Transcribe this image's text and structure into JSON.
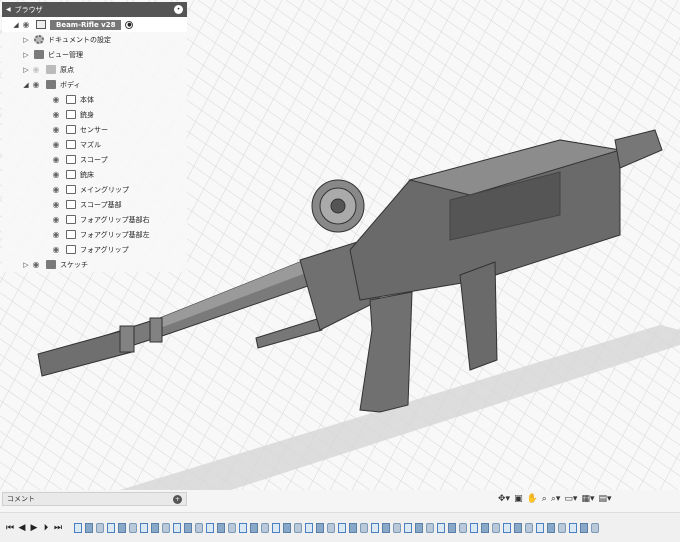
{
  "browser": {
    "title": "ブラウザ",
    "root": "Beam-Rifle v28",
    "items": [
      {
        "label": "ドキュメントの設定",
        "kind": "gear"
      },
      {
        "label": "ビュー管理",
        "kind": "folder"
      },
      {
        "label": "原点",
        "kind": "folder-light"
      },
      {
        "label": "ボディ",
        "kind": "folder"
      },
      {
        "label": "本体",
        "kind": "body"
      },
      {
        "label": "銃身",
        "kind": "body"
      },
      {
        "label": "センサー",
        "kind": "body"
      },
      {
        "label": "マズル",
        "kind": "body"
      },
      {
        "label": "スコープ",
        "kind": "body"
      },
      {
        "label": "銃床",
        "kind": "body"
      },
      {
        "label": "メイングリップ",
        "kind": "body"
      },
      {
        "label": "スコープ基部",
        "kind": "body"
      },
      {
        "label": "フォアグリップ基部右",
        "kind": "body"
      },
      {
        "label": "フォアグリップ基部左",
        "kind": "body"
      },
      {
        "label": "フォアグリップ",
        "kind": "body"
      },
      {
        "label": "スケッチ",
        "kind": "folder"
      }
    ]
  },
  "comment": {
    "title": "コメント"
  },
  "navbar": {
    "icons": [
      "orbit-icon",
      "pan-icon",
      "hand-icon",
      "zoom-icon",
      "display-icon",
      "grid-icon",
      "viewport-icon"
    ]
  },
  "timeline": {
    "controls": [
      "⏮",
      "◀",
      "▶",
      "▶",
      "⏭"
    ],
    "items_count": 48
  },
  "colors": {
    "accent": "#4a7fc0",
    "panel": "#555555",
    "model": "#6e6e6e"
  }
}
